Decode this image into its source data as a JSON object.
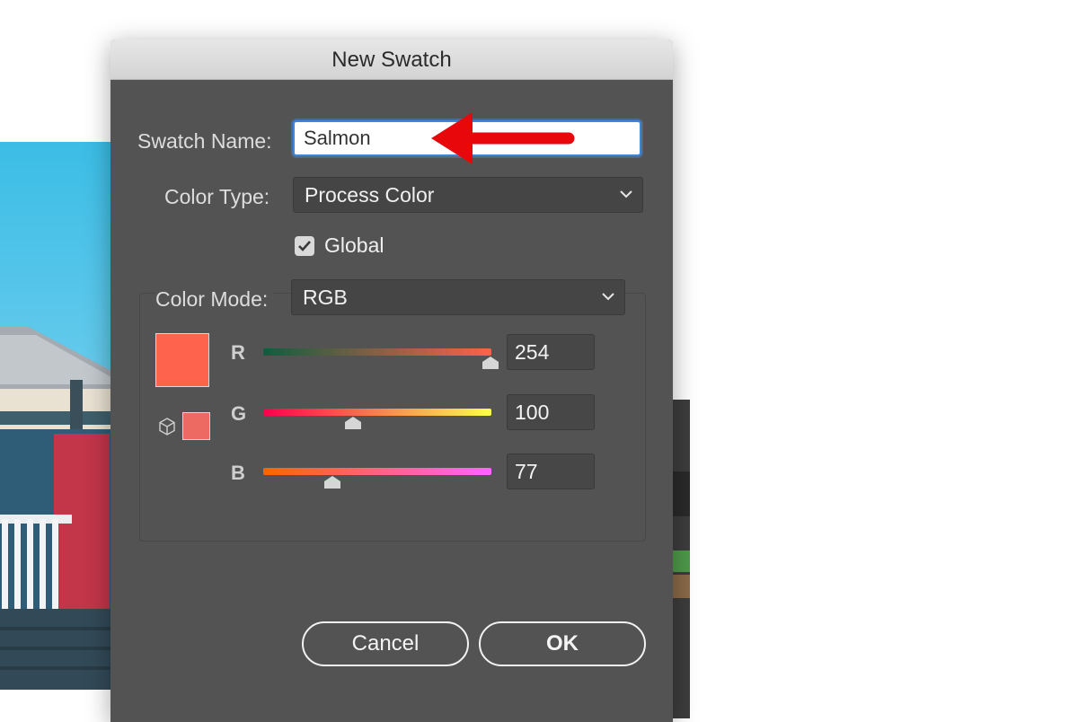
{
  "dialog": {
    "title": "New Swatch"
  },
  "form": {
    "swatch_name_label": "Swatch Name:",
    "swatch_name_value": "Salmon",
    "color_type_label": "Color Type:",
    "color_type_value": "Process Color",
    "global_label": "Global",
    "global_checked": true,
    "color_mode_label": "Color Mode:",
    "color_mode_value": "RGB"
  },
  "channels": {
    "r": {
      "label": "R",
      "value": "254",
      "level": 0.996
    },
    "g": {
      "label": "G",
      "value": "100",
      "level": 0.392
    },
    "b": {
      "label": "B",
      "value": "77",
      "level": 0.302
    }
  },
  "swatch": {
    "current_color": "#FE644D",
    "previous_color": "#ED6A62"
  },
  "buttons": {
    "cancel": "Cancel",
    "ok": "OK"
  },
  "annotation": {
    "arrow_color": "#E8070B"
  },
  "icons": [
    "chevron-down-icon",
    "checkmark-icon",
    "out-of-gamut-cube-icon",
    "slider-thumb-icon"
  ]
}
